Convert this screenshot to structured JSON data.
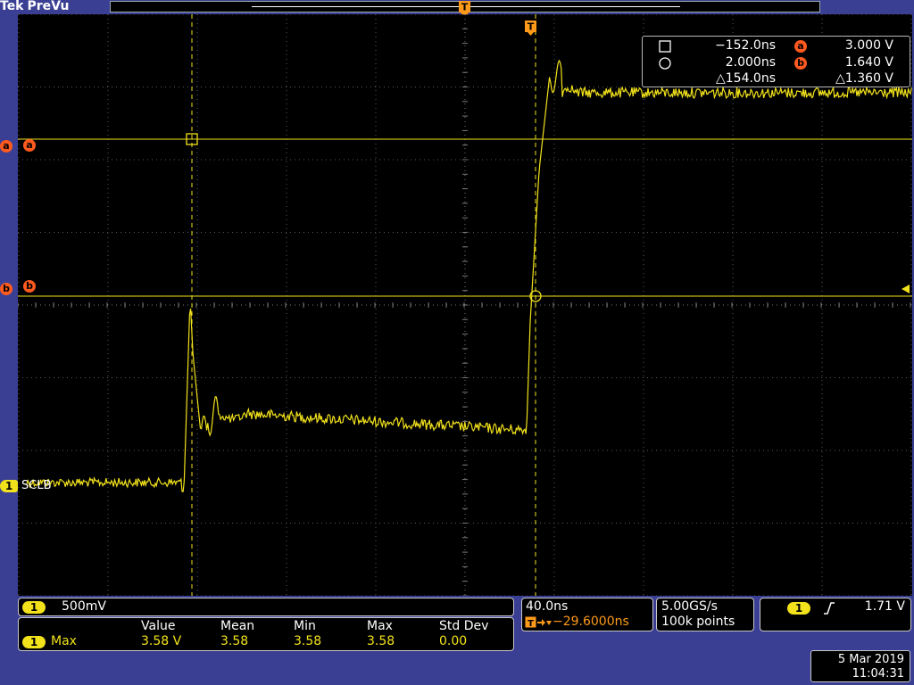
{
  "header": {
    "brand": "Tek",
    "mode": "PreVu"
  },
  "colors": {
    "trace": "#f2e21b",
    "cursor_badge": "#ff5a1f",
    "trigger_marker": "#ff9a1a",
    "background": "#000000",
    "frame": "#3a3f94"
  },
  "cursor_labels": {
    "a": "a",
    "b": "b",
    "trigger": "T"
  },
  "channel": {
    "number": "1",
    "label": "SCLB",
    "scale": "500mV"
  },
  "cursor_readout": {
    "t1": "−152.0ns",
    "t2": "2.000ns",
    "delta_t": "△154.0ns",
    "a_value": "3.000 V",
    "b_value": "1.640 V",
    "delta_v": "△1.360 V",
    "a_badge": "a",
    "b_badge": "b"
  },
  "timebase": {
    "scale": "40.0ns",
    "trigger_position": "−29.6000ns",
    "sample_rate": "5.00GS/s",
    "record_length": "100k points"
  },
  "trigger": {
    "source": "1",
    "slope_icon": "rising-edge-icon",
    "level": "1.71 V"
  },
  "measurement": {
    "source": "1",
    "name": "Max",
    "headers": [
      "Value",
      "Mean",
      "Min",
      "Max",
      "Std Dev"
    ],
    "values": [
      "3.58 V",
      "3.58",
      "3.58",
      "3.58",
      "0.00"
    ]
  },
  "datetime": {
    "date": "5 Mar 2019",
    "time": "11:04:31"
  }
}
